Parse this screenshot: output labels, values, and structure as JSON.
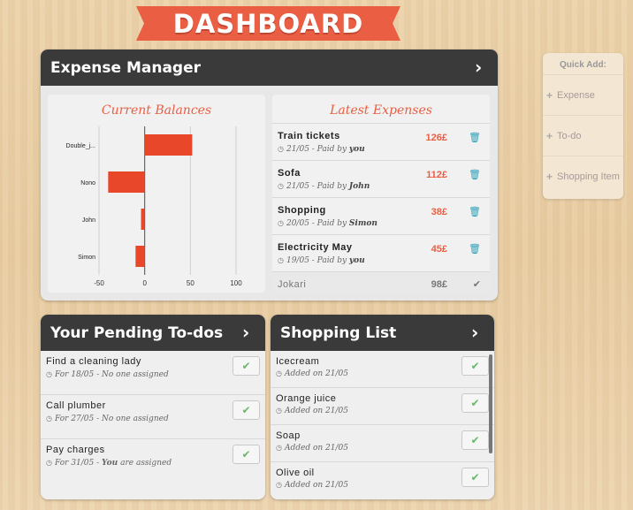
{
  "header": {
    "title": "DASHBOARD"
  },
  "expense_manager": {
    "title": "Expense Manager",
    "balances": {
      "title": "Current Balances",
      "chart_data": {
        "type": "bar",
        "orientation": "horizontal",
        "categories": [
          "Double_j...",
          "Nono",
          "John",
          "Simon"
        ],
        "values": [
          52,
          -40,
          -4,
          -10
        ],
        "xlim": [
          -50,
          100
        ],
        "xticks": [
          "-50",
          "0",
          "50",
          "100"
        ],
        "grid": true
      }
    },
    "latest": {
      "title": "Latest Expenses",
      "items": [
        {
          "name": "Train tickets",
          "date": "21/05 - Paid by ",
          "payer": "you",
          "amount": "126£"
        },
        {
          "name": "Sofa",
          "date": "21/05 - Paid by ",
          "payer": "John",
          "amount": "112£"
        },
        {
          "name": "Shopping",
          "date": "20/05 - Paid by ",
          "payer": "Simon",
          "amount": "38£"
        },
        {
          "name": "Electricity May",
          "date": "19/05 - Paid by ",
          "payer": "you",
          "amount": "45£"
        }
      ],
      "extra": {
        "name": "Jokari",
        "amount": "98£"
      }
    }
  },
  "todos": {
    "title": "Your Pending To-dos",
    "items": [
      {
        "name": "Find a cleaning lady",
        "meta": "For 18/05 - No one assigned"
      },
      {
        "name": "Call plumber",
        "meta": "For 27/05 - No one assigned"
      },
      {
        "name": "Pay charges",
        "meta_pre": "For 31/05 - ",
        "meta_bold": "You",
        "meta_post": " are assigned"
      }
    ]
  },
  "shopping": {
    "title": "Shopping List",
    "items": [
      {
        "name": "Icecream",
        "meta": "Added on 21/05"
      },
      {
        "name": "Orange juice",
        "meta": "Added on 21/05"
      },
      {
        "name": "Soap",
        "meta": "Added on 21/05"
      },
      {
        "name": "Olive oil",
        "meta": "Added on 21/05"
      }
    ]
  },
  "quick_add": {
    "title": "Quick Add:",
    "items": [
      "Expense",
      "To-do",
      "Shopping Item"
    ]
  },
  "colors": {
    "accent": "#ea5e43",
    "header_bg": "#3a3a3a",
    "trash": "#2aa0b8",
    "check": "#6bb86b"
  },
  "icons": {
    "chevron": "chevron-right-icon",
    "trash": "trash-icon",
    "check": "check-icon",
    "clock": "clock-icon",
    "plus": "plus-icon"
  }
}
